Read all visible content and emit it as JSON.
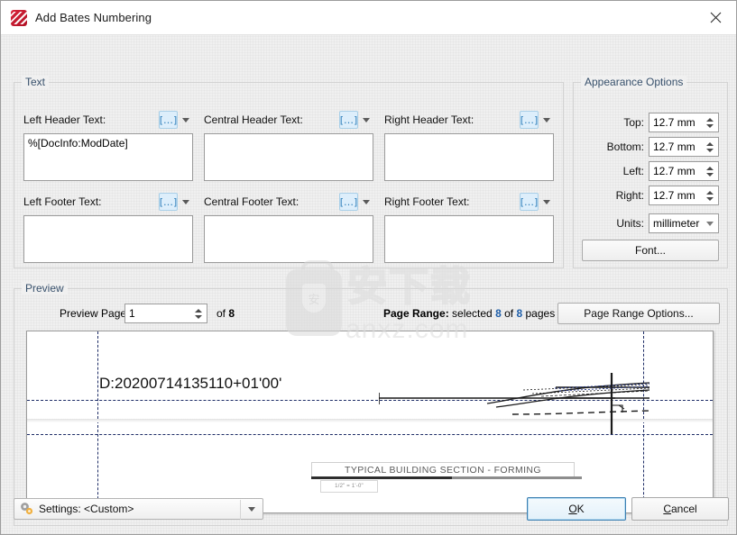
{
  "window": {
    "title": "Add Bates Numbering",
    "icon": "pdf-xchange-icon",
    "close_label": "close-icon"
  },
  "text_group": {
    "legend": "Text",
    "macro_button_glyph": "[…]",
    "fields": [
      {
        "label": "Left Header Text:",
        "value": "%[DocInfo:ModDate]",
        "name": "left-header-text"
      },
      {
        "label": "Central Header Text:",
        "value": "",
        "name": "central-header-text"
      },
      {
        "label": "Right Header Text:",
        "value": "",
        "name": "right-header-text"
      },
      {
        "label": "Left Footer Text:",
        "value": "",
        "name": "left-footer-text"
      },
      {
        "label": "Central Footer Text:",
        "value": "",
        "name": "central-footer-text"
      },
      {
        "label": "Right Footer Text:",
        "value": "",
        "name": "right-footer-text"
      }
    ]
  },
  "appearance": {
    "legend": "Appearance Options",
    "margins": [
      {
        "label": "Top:",
        "value": "12.7 mm"
      },
      {
        "label": "Bottom:",
        "value": "12.7 mm"
      },
      {
        "label": "Left:",
        "value": "12.7 mm"
      },
      {
        "label": "Right:",
        "value": "12.7 mm"
      }
    ],
    "units": {
      "label": "Units:",
      "value": "millimeter"
    },
    "font_button": "Font..."
  },
  "preview": {
    "legend": "Preview",
    "page_label": "Preview Page",
    "page_value": "1",
    "of_prefix": "of",
    "page_total": "8",
    "page_range_prefix": "Page Range:",
    "page_range_mid": "selected",
    "page_range_selected": "8",
    "page_range_of": "of",
    "page_range_total": "8",
    "page_range_suffix": "pages",
    "page_range_button": "Page Range Options...",
    "stamped_header_text": "D:20200714135110+01'00'",
    "drawing_title": "TYPICAL BUILDING SECTION - FORMING",
    "drawing_scale": "1/2\" = 1'-0\""
  },
  "footer": {
    "settings_label": "Settings:",
    "settings_value": "<Custom>",
    "ok_pre": "O",
    "ok_post": "K",
    "cancel_pre": "C",
    "cancel_post": "ancel"
  },
  "watermark": {
    "cn": "安下载",
    "badge": "安",
    "url": "anxz.com"
  },
  "colors": {
    "accent": "#3c7fb1",
    "legend": "#37506b",
    "guide": "#1d2c66",
    "macro": "#2f7fba"
  }
}
